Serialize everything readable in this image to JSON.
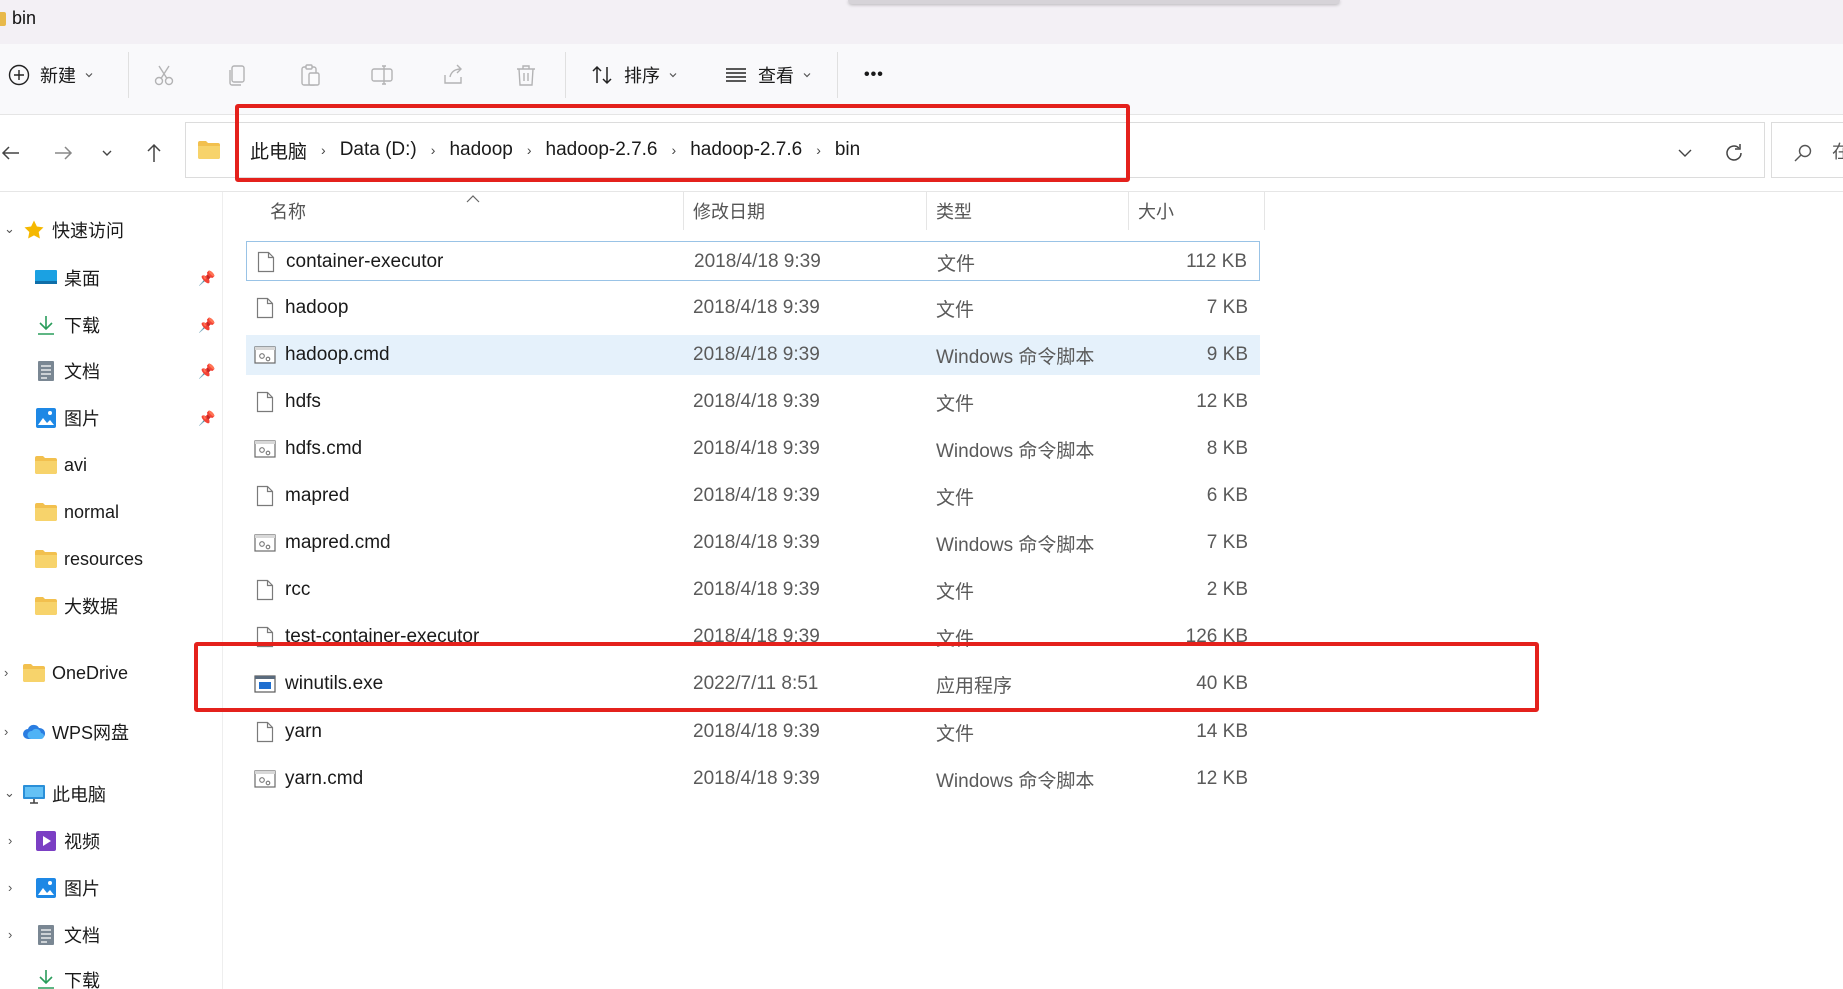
{
  "window": {
    "title": "bin"
  },
  "toolbar": {
    "new_label": "新建",
    "sort_label": "排序",
    "view_label": "查看",
    "more_label": "•••"
  },
  "address": {
    "crumbs": [
      "此电脑",
      "Data (D:)",
      "hadoop",
      "hadoop-2.7.6",
      "hadoop-2.7.6",
      "bin"
    ],
    "search_cut_text": "在"
  },
  "sidebar": {
    "quick_access": "快速访问",
    "items": [
      {
        "label": "桌面",
        "icon": "desktop-icon"
      },
      {
        "label": "下载",
        "icon": "download-icon"
      },
      {
        "label": "文档",
        "icon": "document-icon"
      },
      {
        "label": "图片",
        "icon": "pictures-icon"
      },
      {
        "label": "avi",
        "icon": "folder-icon"
      },
      {
        "label": "normal",
        "icon": "folder-icon"
      },
      {
        "label": "resources",
        "icon": "folder-icon"
      },
      {
        "label": "大数据",
        "icon": "folder-icon"
      }
    ],
    "onedrive": "OneDrive",
    "wps": "WPS网盘",
    "this_pc": "此电脑",
    "pc_items": [
      {
        "label": "视频",
        "icon": "video-icon"
      },
      {
        "label": "图片",
        "icon": "pictures-icon"
      },
      {
        "label": "文档",
        "icon": "document-icon"
      },
      {
        "label": "下载",
        "icon": "download-icon"
      }
    ]
  },
  "columns": {
    "name": "名称",
    "date": "修改日期",
    "type": "类型",
    "size": "大小"
  },
  "files": [
    {
      "name": "container-executor",
      "date": "2018/4/18 9:39",
      "type": "文件",
      "size": "112 KB",
      "icon": "file-icon"
    },
    {
      "name": "hadoop",
      "date": "2018/4/18 9:39",
      "type": "文件",
      "size": "7 KB",
      "icon": "file-icon"
    },
    {
      "name": "hadoop.cmd",
      "date": "2018/4/18 9:39",
      "type": "Windows 命令脚本",
      "size": "9 KB",
      "icon": "cmd-script-icon"
    },
    {
      "name": "hdfs",
      "date": "2018/4/18 9:39",
      "type": "文件",
      "size": "12 KB",
      "icon": "file-icon"
    },
    {
      "name": "hdfs.cmd",
      "date": "2018/4/18 9:39",
      "type": "Windows 命令脚本",
      "size": "8 KB",
      "icon": "cmd-script-icon"
    },
    {
      "name": "mapred",
      "date": "2018/4/18 9:39",
      "type": "文件",
      "size": "6 KB",
      "icon": "file-icon"
    },
    {
      "name": "mapred.cmd",
      "date": "2018/4/18 9:39",
      "type": "Windows 命令脚本",
      "size": "7 KB",
      "icon": "cmd-script-icon"
    },
    {
      "name": "rcc",
      "date": "2018/4/18 9:39",
      "type": "文件",
      "size": "2 KB",
      "icon": "file-icon"
    },
    {
      "name": "test-container-executor",
      "date": "2018/4/18 9:39",
      "type": "文件",
      "size": "126 KB",
      "icon": "file-icon"
    },
    {
      "name": "winutils.exe",
      "date": "2022/7/11 8:51",
      "type": "应用程序",
      "size": "40 KB",
      "icon": "exe-icon"
    },
    {
      "name": "yarn",
      "date": "2018/4/18 9:39",
      "type": "文件",
      "size": "14 KB",
      "icon": "file-icon"
    },
    {
      "name": "yarn.cmd",
      "date": "2018/4/18 9:39",
      "type": "Windows 命令脚本",
      "size": "12 KB",
      "icon": "cmd-script-icon"
    }
  ],
  "colors": {
    "highlight_red": "#e4211c",
    "selection_border": "#99c3e6",
    "hover_bg": "#e5f1fb",
    "folder": "#e8b94a"
  }
}
